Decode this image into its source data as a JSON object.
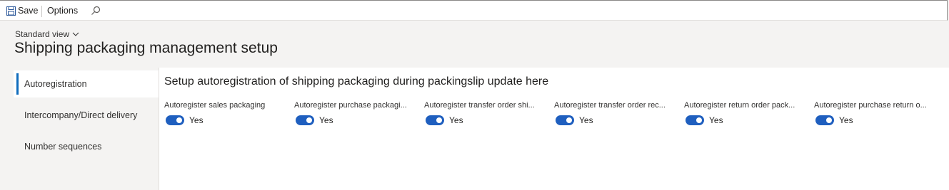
{
  "toolbar": {
    "save_label": "Save",
    "options_label": "Options",
    "search_icon": "search-icon"
  },
  "header": {
    "view_selector": "Standard view",
    "title": "Shipping packaging management setup"
  },
  "nav": {
    "items": [
      "Autoregistration",
      "Intercompany/Direct delivery",
      "Number sequences"
    ],
    "active": "Autoregistration"
  },
  "main": {
    "section_title": "Setup autoregistration of shipping packaging during packingslip update here",
    "fields": [
      {
        "label": "Autoregister sales packaging",
        "value": "Yes"
      },
      {
        "label": "Autoregister purchase packagi...",
        "value": "Yes"
      },
      {
        "label": "Autoregister transfer order shi...",
        "value": "Yes"
      },
      {
        "label": "Autoregister transfer order rec...",
        "value": "Yes"
      },
      {
        "label": "Autoregister return order pack...",
        "value": "Yes"
      },
      {
        "label": "Autoregister purchase return o...",
        "value": "Yes"
      }
    ]
  },
  "colors": {
    "accent": "#1f5fbf",
    "nav_indicator": "#0f6cbd",
    "page_bg": "#f4f3f2"
  }
}
